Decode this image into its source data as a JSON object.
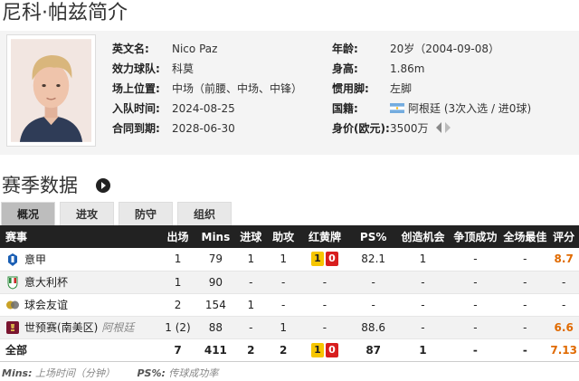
{
  "page_title": "尼科·帕兹简介",
  "profile": {
    "english_name": {
      "label": "英文名:",
      "value": "Nico Paz"
    },
    "club": {
      "label": "效力球队:",
      "value": "科莫"
    },
    "position": {
      "label": "场上位置:",
      "value": "中场（前腰、中场、中锋）"
    },
    "joined": {
      "label": "入队时间:",
      "value": "2024-08-25"
    },
    "contract": {
      "label": "合同到期:",
      "value": "2028-06-30"
    },
    "age": {
      "label": "年龄:",
      "value": "20岁（2004-09-08）"
    },
    "height": {
      "label": "身高:",
      "value": "1.86m"
    },
    "foot": {
      "label": "惯用脚:",
      "value": "左脚"
    },
    "nationality": {
      "label": "国籍:",
      "value": "阿根廷 (3次入选 / 进0球)"
    },
    "market_value": {
      "label": "身价(欧元):",
      "value": "3500万"
    }
  },
  "season_title": "赛季数据",
  "tabs": [
    {
      "label": "概况",
      "active": true
    },
    {
      "label": "进攻",
      "active": false
    },
    {
      "label": "防守",
      "active": false
    },
    {
      "label": "组织",
      "active": false
    }
  ],
  "table": {
    "headers": [
      "赛事",
      "出场",
      "Mins",
      "进球",
      "助攻",
      "红黄牌",
      "PS%",
      "创造机会",
      "争顶成功",
      "全场最佳",
      "评分"
    ],
    "rows": [
      {
        "competition": "意甲",
        "icon": "serie-a-icon",
        "team_note": "",
        "apps": "1",
        "mins": "79",
        "goals": "1",
        "assists": "1",
        "yellow": "1",
        "red": "0",
        "ps": "82.1",
        "chances": "1",
        "aerials": "-",
        "motm": "-",
        "rating": "8.7"
      },
      {
        "competition": "意大利杯",
        "icon": "coppa-italia-icon",
        "team_note": "",
        "apps": "1",
        "mins": "90",
        "goals": "-",
        "assists": "-",
        "yellow": "",
        "red": "",
        "ps": "-",
        "chances": "-",
        "aerials": "-",
        "motm": "-",
        "rating": "-"
      },
      {
        "competition": "球会友谊",
        "icon": "club-friendly-icon",
        "team_note": "",
        "apps": "2",
        "mins": "154",
        "goals": "1",
        "assists": "-",
        "yellow": "",
        "red": "",
        "ps": "-",
        "chances": "-",
        "aerials": "-",
        "motm": "-",
        "rating": "-"
      },
      {
        "competition": "世预赛(南美区)",
        "icon": "wc-qualifier-icon",
        "team_note": "阿根廷",
        "apps": "1 (2)",
        "mins": "88",
        "goals": "-",
        "assists": "1",
        "yellow": "",
        "red": "",
        "ps": "88.6",
        "chances": "-",
        "aerials": "-",
        "motm": "-",
        "rating": "6.6"
      }
    ],
    "total": {
      "competition": "全部",
      "apps": "7",
      "mins": "411",
      "goals": "2",
      "assists": "2",
      "yellow": "1",
      "red": "0",
      "ps": "87",
      "chances": "1",
      "aerials": "-",
      "motm": "-",
      "rating": "7.13"
    }
  },
  "footnote": {
    "mins_key": "Mins:",
    "mins_desc": " 上场时间（分钟）",
    "ps_key": "PS%:",
    "ps_desc": " 传球成功率"
  },
  "colors": {
    "rating": "#e06a00",
    "header_bg": "#222222",
    "yellow_card": "#f7c600",
    "red_card": "#d81e1e"
  }
}
